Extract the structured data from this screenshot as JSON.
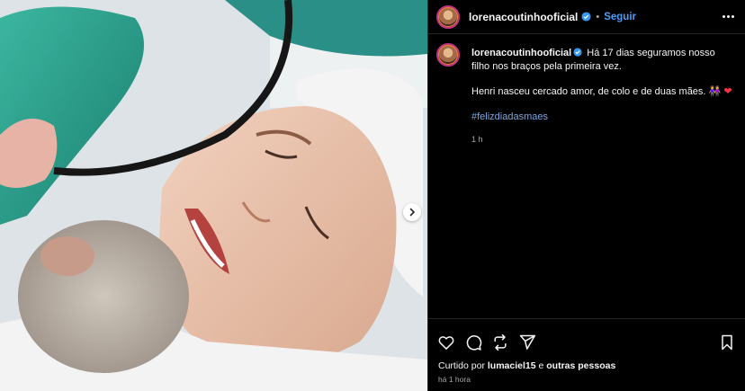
{
  "post": {
    "username": "lorenacoutinhooficial",
    "follow_label": "Seguir",
    "dot": "•",
    "caption_line1": "Há 17 dias seguramos nosso filho nos braços pela primeira vez.",
    "caption_line2": "Henri nasceu cercado amor, de colo e de duas mães.",
    "caption_emoji": "👭",
    "caption_heart": "❤",
    "hashtag": "#felizdiadasmaes",
    "caption_time": "1 h",
    "liked_prefix": "Curtido por",
    "liked_user": "lumaciel15",
    "liked_and": "e",
    "liked_others": "outras pessoas",
    "posted_ago": "há 1 hora"
  },
  "colors": {
    "background": "#000000",
    "link_blue": "#4a9df8",
    "hashtag": "#7fa6e0",
    "verified": "#3897f0",
    "muted": "#a8a8a8"
  },
  "icons": {
    "like": "heart-icon",
    "comment": "comment-icon",
    "share": "repost-icon",
    "send": "send-icon",
    "save": "bookmark-icon",
    "more": "more-options-icon",
    "next": "chevron-right-icon"
  }
}
